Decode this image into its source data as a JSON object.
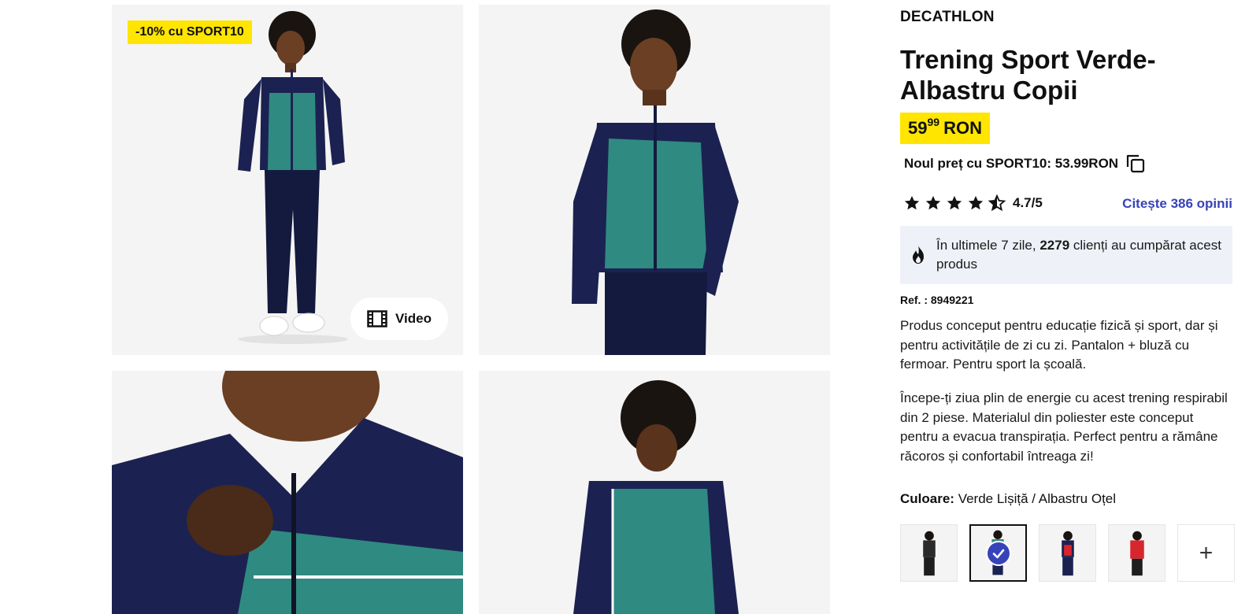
{
  "gallery": {
    "promo_badge": "-10% cu SPORT10",
    "video_label": "Video",
    "images": [
      "full-body-front",
      "upper-body-side",
      "zipper-closeup",
      "back-view"
    ]
  },
  "product": {
    "brand": "DECATHLON",
    "title": "Trening Sport Verde-Albastru Copii",
    "price_int": "59",
    "price_dec": "99",
    "currency": "RON",
    "promo_price_text": "Noul preț cu SPORT10: 53.99RON",
    "rating": {
      "stars": 4.5,
      "text": "4.7/5"
    },
    "reviews_link": "Citește 386 opinii",
    "social_proof": {
      "before": "În ultimele 7 zile, ",
      "count": "2279",
      "after": " clienți au cumpărat acest produs"
    },
    "ref": "Ref. : 8949221",
    "description_1": "Produs conceput pentru educație fizică și sport, dar și pentru activitățile de zi cu zi. Pantalon + bluză cu fermoar. Pentru sport la școală.",
    "description_2": "Începe-ți ziua plin de energie cu acest trening respirabil din 2 piese. Materialul din poliester este conceput pentru a evacua transpirația. Perfect pentru a rămâne răcoros și confortabil întreaga zi!",
    "colour_label": "Culoare:",
    "colour_value": " Verde Lișiță / Albastru Oțel",
    "more_colours": "+"
  },
  "colors": {
    "accent_yellow": "#ffe500",
    "link_blue": "#3643ba",
    "navy": "#1b2251",
    "teal": "#2f8a82",
    "red": "#d8262f"
  },
  "icons": [
    "film-icon",
    "copy-icon",
    "star-icon",
    "star-half-icon",
    "fire-icon",
    "check-icon",
    "plus-icon"
  ]
}
